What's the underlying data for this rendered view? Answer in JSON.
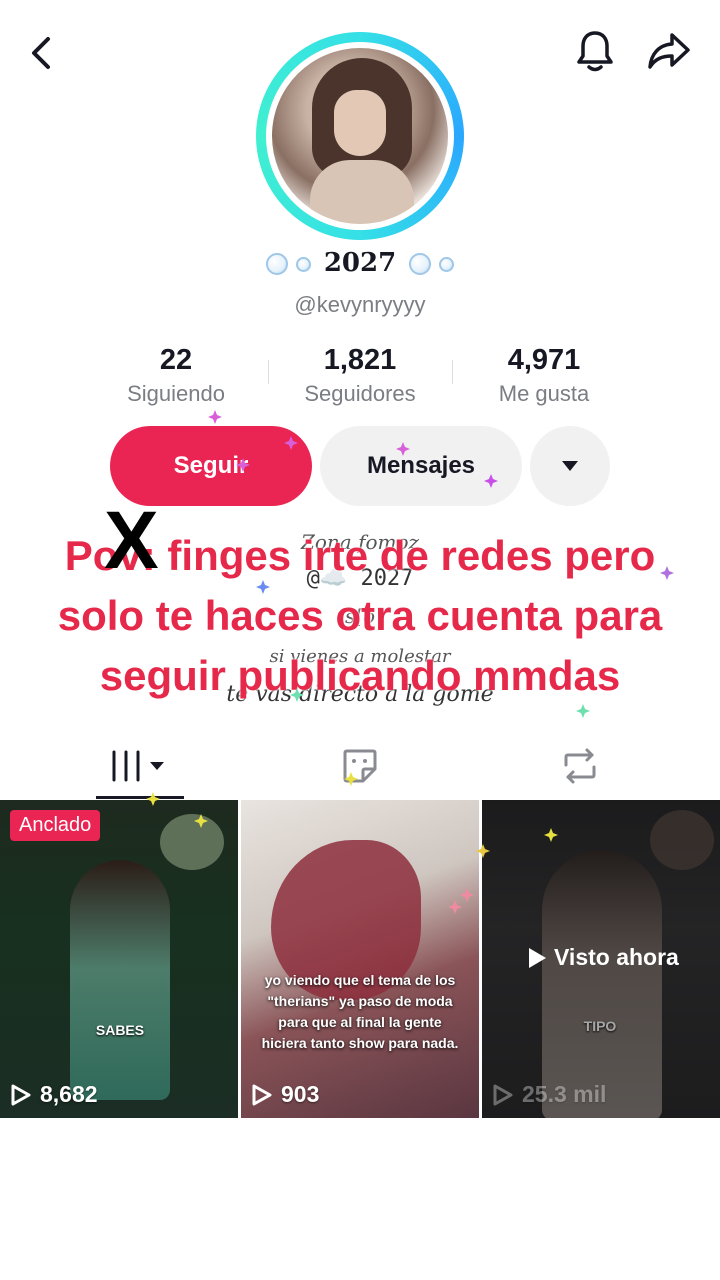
{
  "header": {
    "back_icon": "chevron-left-icon",
    "notification_icon": "bell-icon",
    "share_icon": "share-arrow-icon"
  },
  "profile": {
    "display_name": "2027",
    "username": "@kevynryyyy",
    "ring_color": "#35e0e6"
  },
  "stats": [
    {
      "value": "22",
      "label": "Siguiendo"
    },
    {
      "value": "1,821",
      "label": "Seguidores"
    },
    {
      "value": "4,971",
      "label": "Me gusta"
    }
  ],
  "actions": {
    "follow_label": "Seguir",
    "message_label": "Mensajes",
    "more_icon": "caret-down-icon",
    "follow_color": "#ea2553"
  },
  "bio": {
    "line1": "Zona fomoz",
    "line2": "@☁️ 2027",
    "line3": "s[o",
    "line4": "si vienes a molestar",
    "line5": "te vas directo a la gome"
  },
  "overlay": {
    "caption": "Pov: finges irte de redes pero solo te haces otra cuenta para seguir publicando mmdas",
    "mark": "X",
    "caption_color": "#e6294a"
  },
  "tabs": {
    "videos_icon": "grid-icon",
    "stickers_icon": "sticker-icon",
    "reposts_icon": "repost-icon"
  },
  "videos": [
    {
      "pinned_label": "Anclado",
      "caption": "SABES",
      "plays": "8,682"
    },
    {
      "text": "yo viendo que el tema de los \"therians\" ya paso de moda para que al final la gente hiciera tanto show para nada.",
      "plays": "903"
    },
    {
      "watched_label": "Visto ahora",
      "caption": "TIPO",
      "plays": "25.3 mil"
    }
  ]
}
